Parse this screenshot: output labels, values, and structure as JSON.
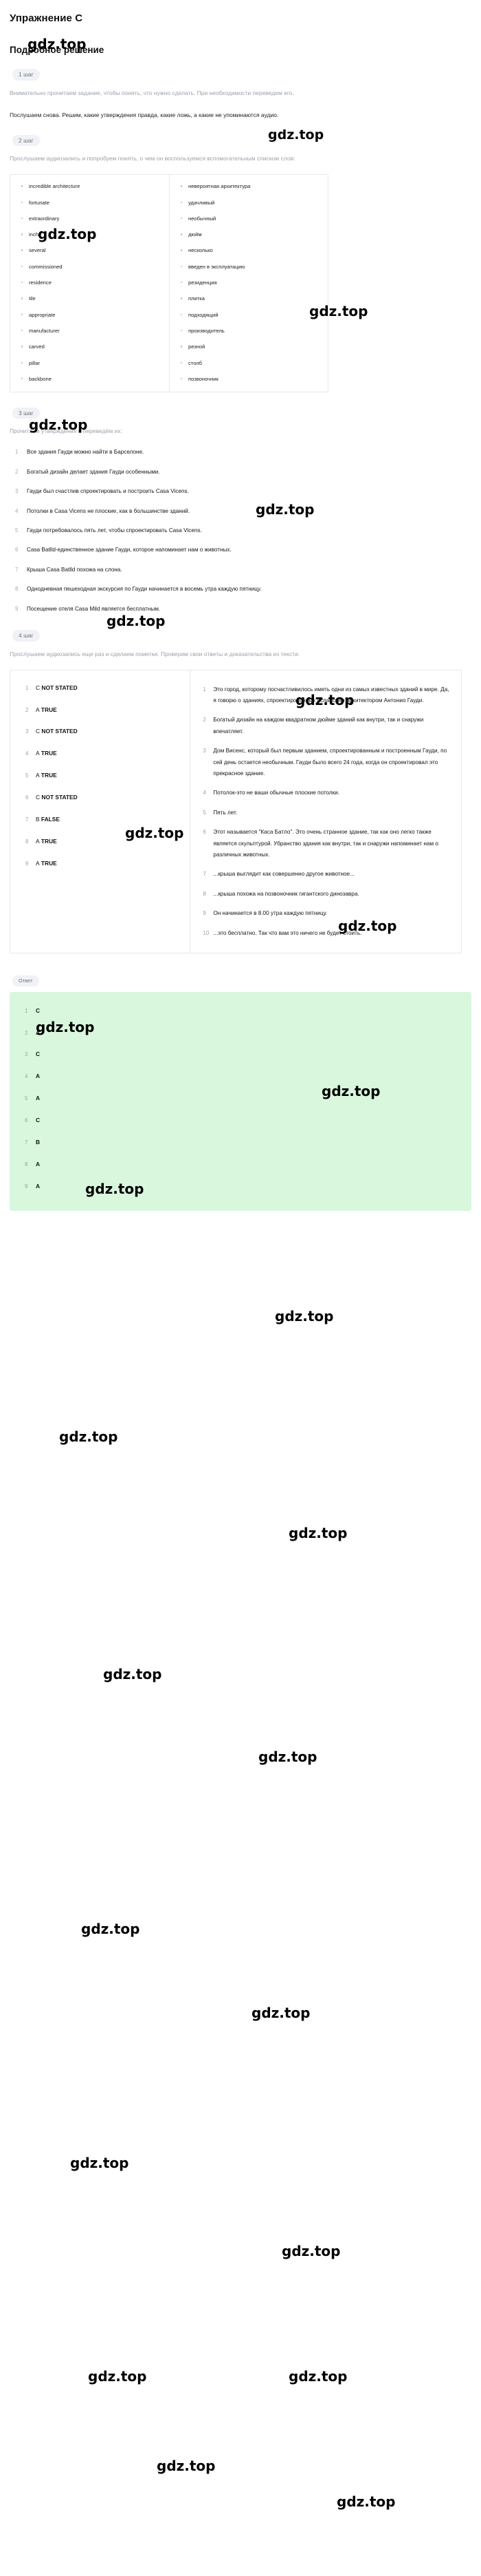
{
  "header": {
    "exercise_title": "Упражнение C",
    "solution_title": "Подробное решение"
  },
  "watermark": {
    "text": "gdz.top"
  },
  "steps": [
    {
      "badge": "1 шаг",
      "intro": "Внимательно прочитаем задание, чтобы понять, что нужно сделать. При необходимости переведем его.",
      "task": "Послушаем снова. Решим, какие утверждения правда, какие ложь, а какие не упоминаются аудио."
    },
    {
      "badge": "2 шаг",
      "intro": "Прослушаем аудиозапись и попробуем понять, о чем он воспользуемся вспомогательным списком слов:"
    },
    {
      "badge": "3 шаг",
      "intro": "Прочитаем утверждения и переведём их:"
    },
    {
      "badge": "4 шаг",
      "intro": "Прослушаем аудиозапись еще раз и сделаем пометки. Проверим свои ответы и доказательства из текста:"
    }
  ],
  "vocabulary": {
    "english": [
      "incredible architecture",
      "fortunate",
      "extraordinary",
      "inch",
      "several",
      "commissioned",
      "residence",
      "tile",
      "appropriate",
      "manufacturer",
      "carved",
      "pillar",
      "backbone"
    ],
    "russian": [
      "невероятная архитектура",
      "удачливый",
      "необычный",
      "дюйм",
      "несколько",
      "введен в эксплуатацию",
      "резиденция",
      "плитка",
      "подходящий",
      "производитель",
      "резной",
      "столб",
      "позвоночник"
    ]
  },
  "statements": [
    "Все здания Гауди можно найти в Барселоне.",
    "Богатый дизайн делает здания Гауди особенными.",
    "Гауди был счастлив спроектировать и построить Casa Vicens.",
    "Потолки в Casa Vicens не плоские, как в большинстве зданий.",
    "Гауди потребовалось пять лет, чтобы спроектировать Casa Vicens.",
    "Casa Batlld-единственное здание Гауди, которое напоминает нам о животных.",
    "Крыша Casa Batlld похожа на слона.",
    "Однодневная пешеходная экскурсия по Гауди начинается в восемь утра каждую пятницу.",
    "Посещение отеля Casa Mild является бесплатным."
  ],
  "answers_with_labels": [
    {
      "letter": "C",
      "label": "NOT STATED"
    },
    {
      "letter": "A",
      "label": "TRUE"
    },
    {
      "letter": "C",
      "label": "NOT STATED"
    },
    {
      "letter": "A",
      "label": "TRUE"
    },
    {
      "letter": "A",
      "label": "TRUE"
    },
    {
      "letter": "C",
      "label": "NOT STATED"
    },
    {
      "letter": "B",
      "label": "FALSE"
    },
    {
      "letter": "A",
      "label": "TRUE"
    },
    {
      "letter": "A",
      "label": "TRUE"
    }
  ],
  "evidence": [
    "Это город, которому посчастливилось иметь одни из самых известных зданий в мире. Да, я говорю о зданиях, спроектированных испанским архитектором Антонио Гауди.",
    "Богатый дизайн на каждом квадратном дюйме зданий как внутри, так и снаружи впечатляет.",
    "Дом Висенс, который был первым зданием, спроектированным и построенным Гауди, по сей день остается необычным. Гауди было всего 24 года, когда он спроектировал это прекрасное здание.",
    "Потолок-это не ваши обычные плоские потолки.",
    "Пять лет.",
    "Этот называется \"Каса Батло\". Это очень странное здание, так как оно легко также является скульптурой. Убранство здания как внутри, так и снаружи напоминает нам о различных животных.",
    "...крыша выглядит как совершенно другое животное...",
    "...крыша похожа на позвоночник гигантского динозавра.",
    "Он начинается в 8.00 утра каждую пятницу.",
    "...это бесплатно. Так что вам это ничего не будет стоить."
  ],
  "answer_section": {
    "badge": "Ответ",
    "items": [
      "C",
      "A",
      "C",
      "A",
      "A",
      "C",
      "B",
      "A",
      "A"
    ]
  }
}
